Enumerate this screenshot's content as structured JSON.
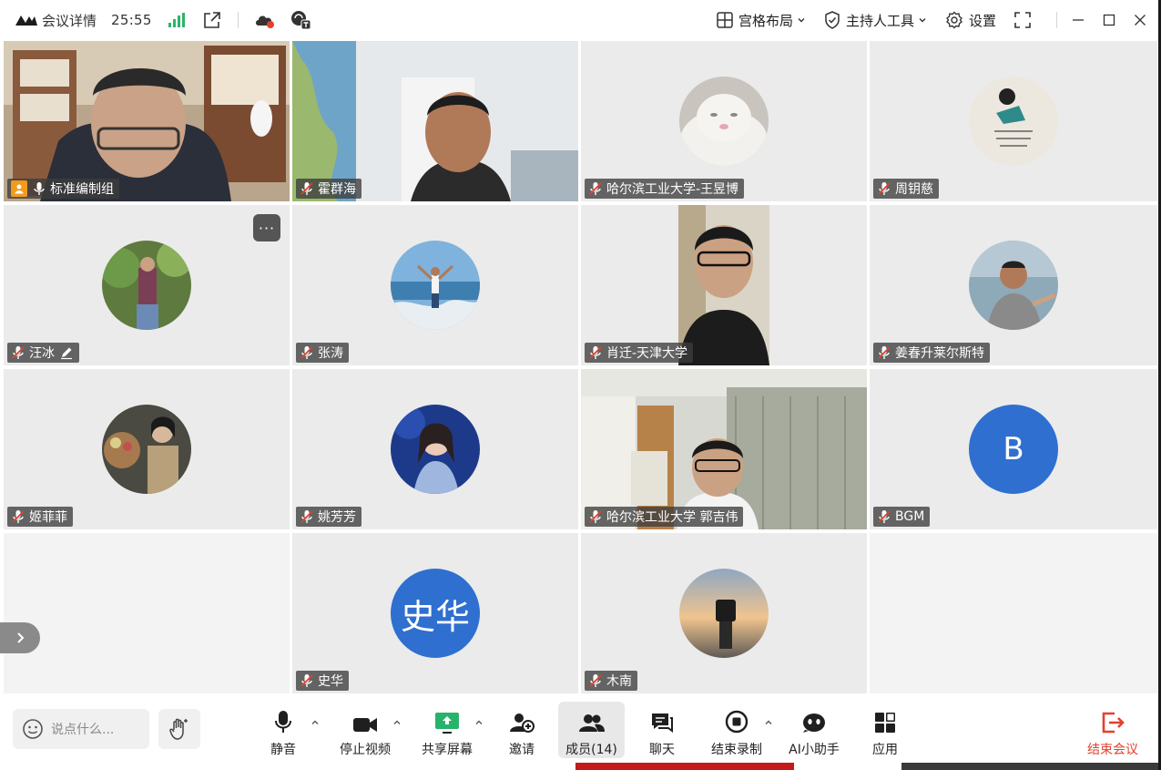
{
  "topbar": {
    "meeting_details": "会议详情",
    "timer": "25:55",
    "layout_label": "宫格布局",
    "host_tools_label": "主持人工具",
    "settings_label": "设置"
  },
  "participants": [
    {
      "name": "标准编制组"
    },
    {
      "name": "霍群海"
    },
    {
      "name": "哈尔滨工业大学-王昱博"
    },
    {
      "name": "周钥慈"
    },
    {
      "name": "汪冰"
    },
    {
      "name": "张涛"
    },
    {
      "name": "肖迁-天津大学"
    },
    {
      "name": "姜春升莱尔斯特"
    },
    {
      "name": "姬菲菲"
    },
    {
      "name": "姚芳芳"
    },
    {
      "name": "哈尔滨工业大学 郭吉伟"
    },
    {
      "name": "BGM",
      "avatar_text": "B"
    },
    {
      "name": "史华",
      "avatar_text": "史华"
    },
    {
      "name": "木南"
    }
  ],
  "toolbar": {
    "chat_placeholder": "说点什么...",
    "mute": "静音",
    "stop_video": "停止视频",
    "share_screen": "共享屏幕",
    "invite": "邀请",
    "members": "成员(14)",
    "chat": "聊天",
    "stop_recording": "结束录制",
    "ai_assistant": "AI小助手",
    "apps": "应用",
    "end_meeting": "结束会议"
  },
  "colors": {
    "active_border": "#2ecc8a",
    "avatar_blue": "#2f6fcf",
    "end_red": "#e3402c",
    "signal_green": "#2fb36a"
  }
}
